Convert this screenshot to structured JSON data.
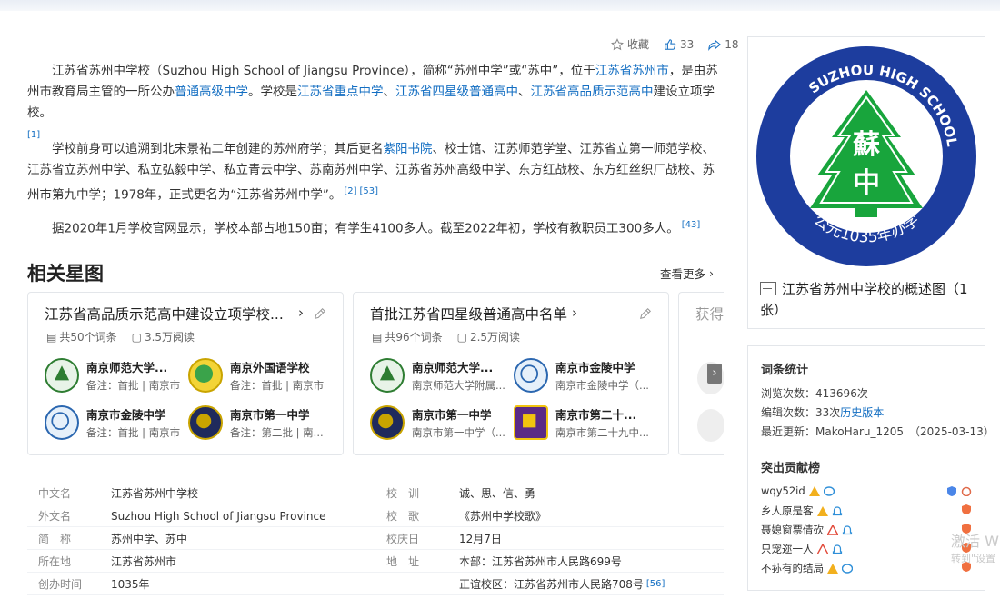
{
  "toolbar": {
    "collect_label": "收藏",
    "like_count": "33",
    "share_count": "18"
  },
  "intro": {
    "p1_a": "江苏省苏州中学校（Suzhou High School of Jiangsu Province），简称“苏州中学”或“苏中”，位于",
    "p1_link1": "江苏省苏州市",
    "p1_b": "，是由苏州市教育局主管的一所公办",
    "p1_link2": "普通高级中学",
    "p1_c": "。学校是",
    "p1_link3": "江苏省重点中学",
    "p1_d": "、",
    "p1_link4": "江苏省四星级普通高中",
    "p1_e": "、",
    "p1_link5": "江苏省高品质示范高中",
    "p1_f": "建设立项学校。",
    "p1_ref": "[1]",
    "p2_a": "学校前身可以追溯到北宋景祐二年创建的苏州府学；其后更名",
    "p2_link": "紫阳书院",
    "p2_b": "、校士馆、江苏师范学堂、江苏省立第一师范学校、江苏省立苏州中学、私立弘毅中学、私立青云中学、苏南苏州中学、江苏省苏州高级中学、东方红战校、东方红丝织厂战校、苏州市第九中学；1978年，正式更名为“江苏省苏州中学”。",
    "p2_ref1": "[2]",
    "p2_ref2": "[53]",
    "p3": "据2020年1月学校官网显示，学校本部占地150亩；有学生4100多人。截至2022年初，学校有教职员工300多人。",
    "p3_ref": "[43]"
  },
  "related": {
    "title": "相关星图",
    "more": "查看更多",
    "cards": [
      {
        "title": "江苏省高品质示范高中建设立项学校...",
        "count": "共50个词条",
        "reads": "3.5万阅读",
        "entries": [
          {
            "name": "南京师范大学...",
            "note": "备注：首批 | 南京市"
          },
          {
            "name": "南京外国语学校",
            "note": "备注：首批 | 南京市"
          },
          {
            "name": "南京市金陵中学",
            "note": "备注：首批 | 南京市"
          },
          {
            "name": "南京市第一中学",
            "note": "备注：第二批 | 南..."
          }
        ]
      },
      {
        "title": "首批江苏省四星级普通高中名单",
        "count": "共96个词条",
        "reads": "2.5万阅读",
        "entries": [
          {
            "name": "南京师范大学...",
            "note": "南京师范大学附属..."
          },
          {
            "name": "南京市金陵中学",
            "note": "南京市金陵中学（..."
          },
          {
            "name": "南京市第一中学",
            "note": "南京市第一中学（..."
          },
          {
            "name": "南京市第二十...",
            "note": "南京市第二十九中..."
          }
        ]
      },
      {
        "title": "获得"
      }
    ]
  },
  "infobox": {
    "left": [
      {
        "k": "中文名",
        "v": "江苏省苏州中学校"
      },
      {
        "k": "外文名",
        "v": "Suzhou High School of Jiangsu Province"
      },
      {
        "k": "简　称",
        "v": "苏州中学、苏中"
      },
      {
        "k": "所在地",
        "v": "江苏省苏州市"
      },
      {
        "k": "创办时间",
        "v": "1035年"
      }
    ],
    "right": [
      {
        "k": "校　训",
        "v": "诚、思、信、勇"
      },
      {
        "k": "校　歌",
        "v": "《苏州中学校歌》"
      },
      {
        "k": "校庆日",
        "v": "12月7日"
      },
      {
        "k": "地　址",
        "v": "本部：江苏省苏州市人民路699号"
      },
      {
        "k": "",
        "v": "正谊校区：江苏省苏州市人民路708号",
        "ref": "[56]"
      }
    ]
  },
  "logo": {
    "outer_text": "SUZHOU HIGH SCHOOL",
    "bottom_text": "公元1035年办学",
    "center_top": "蘇",
    "center_bottom": "中",
    "blue": "#1d3d9e",
    "green": "#18a53c"
  },
  "image_caption": "江苏省苏州中学校的概述图（1张）",
  "stats": {
    "title": "词条统计",
    "views_label": "浏览次数：",
    "views": "413696次",
    "edits_label": "编辑次数：",
    "edits": "33次",
    "history": "历史版本",
    "updated_label": "最近更新：",
    "updated": "MakoHaru_1205　（2025-03-13）",
    "contrib_title": "突出贡献榜",
    "contributors": [
      "wqy52id",
      "乡人原是客",
      "聂媳窗票倩砍",
      "只宠迩一人",
      "不荪有的结局"
    ]
  },
  "watermark": {
    "line1": "激活 W",
    "line2": "转到\"设置"
  }
}
